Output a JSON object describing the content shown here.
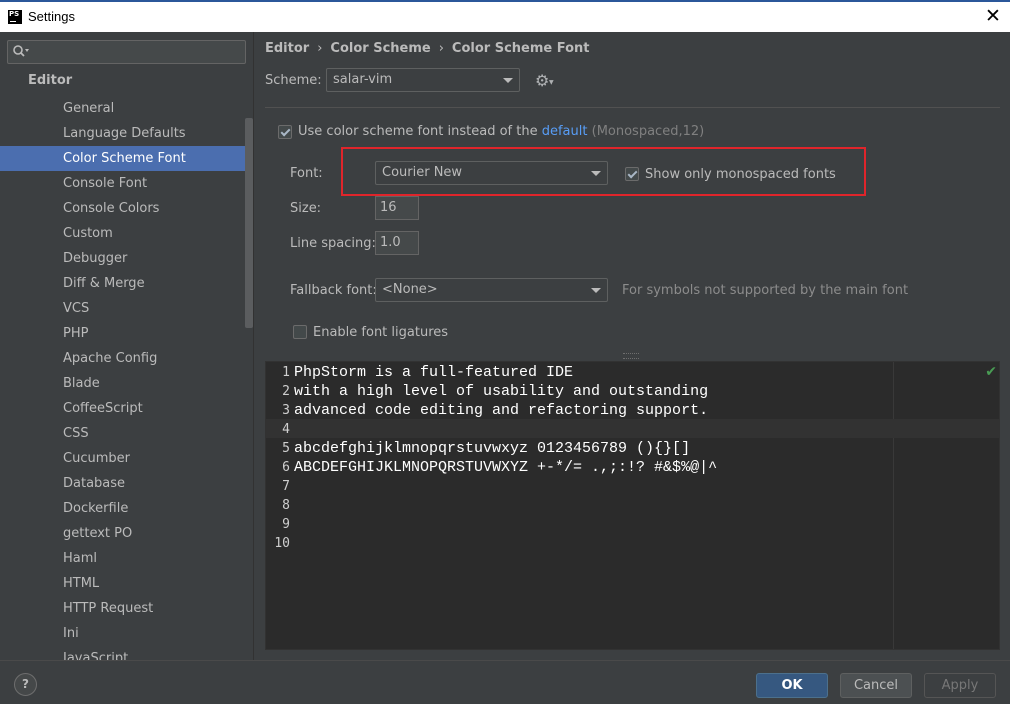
{
  "window": {
    "app_logo": "PS",
    "title": "Settings",
    "close_glyph": "✕"
  },
  "sidebar": {
    "search": {
      "value": "",
      "placeholder": ""
    },
    "heading": "Editor",
    "items": [
      {
        "label": "General"
      },
      {
        "label": "Language Defaults"
      },
      {
        "label": "Color Scheme Font",
        "selected": true
      },
      {
        "label": "Console Font"
      },
      {
        "label": "Console Colors"
      },
      {
        "label": "Custom"
      },
      {
        "label": "Debugger"
      },
      {
        "label": "Diff & Merge"
      },
      {
        "label": "VCS"
      },
      {
        "label": "PHP"
      },
      {
        "label": "Apache Config"
      },
      {
        "label": "Blade"
      },
      {
        "label": "CoffeeScript"
      },
      {
        "label": "CSS"
      },
      {
        "label": "Cucumber"
      },
      {
        "label": "Database"
      },
      {
        "label": "Dockerfile"
      },
      {
        "label": "gettext PO"
      },
      {
        "label": "Haml"
      },
      {
        "label": "HTML"
      },
      {
        "label": "HTTP Request"
      },
      {
        "label": "Ini"
      },
      {
        "label": "JavaScript"
      }
    ]
  },
  "breadcrumb": [
    "Editor",
    "Color Scheme",
    "Color Scheme Font"
  ],
  "breadcrumb_separator": "›",
  "scheme": {
    "label": "Scheme:",
    "value": "salar-vim"
  },
  "use_scheme_font": {
    "checked": true,
    "label": "Use color scheme font instead of the",
    "link": "default",
    "hint": "(Monospaced,12)"
  },
  "font": {
    "label": "Font:",
    "value": "Courier New"
  },
  "show_monospaced": {
    "checked": true,
    "label": "Show only monospaced fonts"
  },
  "size": {
    "label": "Size:",
    "value": "16"
  },
  "line_spacing": {
    "label": "Line spacing:",
    "value": "1.0"
  },
  "fallback_font": {
    "label": "Fallback font:",
    "value": "<None>",
    "hint": "For symbols not supported by the main font"
  },
  "ligatures": {
    "checked": false,
    "label": "Enable font ligatures"
  },
  "preview": {
    "lines": [
      {
        "num": "1",
        "text": "PhpStorm is a full-featured IDE"
      },
      {
        "num": "2",
        "text": "with a high level of usability and outstanding"
      },
      {
        "num": "3",
        "text": "advanced code editing and refactoring support."
      },
      {
        "num": "4",
        "text": ""
      },
      {
        "num": "5",
        "text": "abcdefghijklmnopqrstuvwxyz 0123456789 (){}[]"
      },
      {
        "num": "6",
        "text": "ABCDEFGHIJKLMNOPQRSTUVWXYZ +-*/= .,;:!? #&$%@|^"
      },
      {
        "num": "7",
        "text": ""
      },
      {
        "num": "8",
        "text": ""
      },
      {
        "num": "9",
        "text": ""
      },
      {
        "num": "10",
        "text": ""
      }
    ],
    "current_line": 4,
    "status_glyph": "✔"
  },
  "footer": {
    "help": "?",
    "ok": "OK",
    "cancel": "Cancel",
    "apply": "Apply"
  },
  "colors": {
    "accent": "#4b6eaf",
    "link": "#589df6",
    "highlight_box": "#e0252b",
    "editor_bg": "#2b2b2b",
    "panel_bg": "#3c3f41"
  },
  "icons": {
    "search": "search-icon",
    "gear": "gear-icon",
    "close": "close-icon",
    "help": "help-icon",
    "inspection_ok": "check-icon"
  }
}
